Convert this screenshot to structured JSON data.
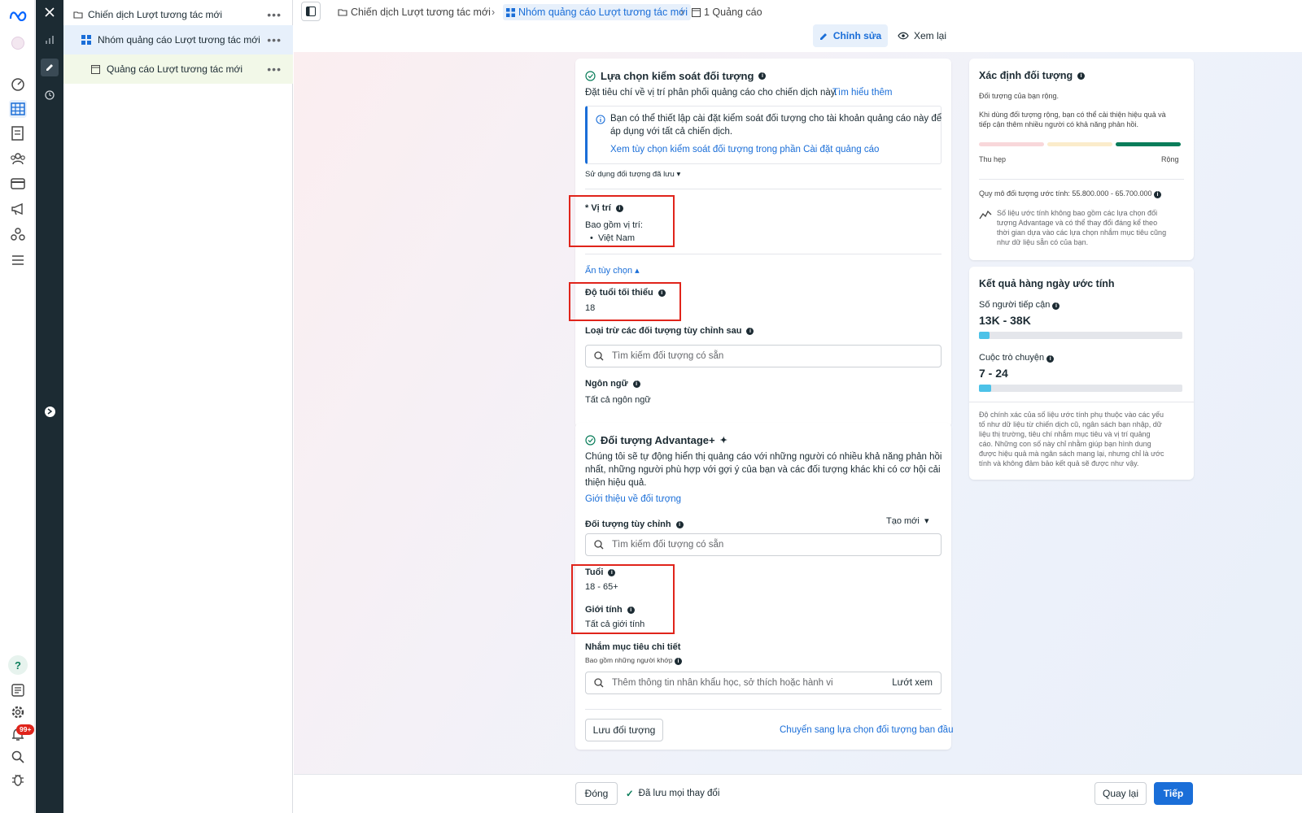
{
  "tree": {
    "campaign": "Chiến dịch Lượt tương tác mới",
    "adset": "Nhóm quảng cáo Lượt tương tác mới",
    "ad": "Quảng cáo Lượt tương tác mới"
  },
  "breadcrumb": {
    "campaign": "Chiến dịch Lượt tương tác mới",
    "adset": "Nhóm quảng cáo Lượt tương tác mới",
    "ads": "1 Quảng cáo"
  },
  "mode": {
    "edit": "Chỉnh sửa",
    "review": "Xem lại"
  },
  "notifications": {
    "badge": "99+"
  },
  "audience_controls": {
    "title": "Lựa chọn kiểm soát đối tượng",
    "desc": "Đặt tiêu chí về vị trí phân phối quảng cáo cho chiến dịch này.",
    "learn_more": "Tìm hiểu thêm",
    "notice_line1": "Bạn có thể thiết lập cài đặt kiểm soát đối tượng cho tài khoản quảng cáo này để",
    "notice_line2": "áp dụng với tất cả chiến dịch.",
    "notice_link": "Xem tùy chọn kiểm soát đối tượng trong phần Cài đặt quảng cáo",
    "saved_audience": "Sử dụng đối tượng đã lưu",
    "location_label": "* Vị trí",
    "location_include": "Bao gồm vị trí:",
    "location_value": "Việt Nam",
    "hide_options": "Ẩn tùy chọn",
    "min_age_label": "Độ tuổi tối thiểu",
    "min_age_value": "18",
    "exclude_label": "Loại trừ các đối tượng tùy chỉnh sau",
    "exclude_placeholder": "Tìm kiếm đối tượng có sẵn",
    "language_label": "Ngôn ngữ",
    "language_value": "Tất cả ngôn ngữ"
  },
  "advantage": {
    "title": "Đối tượng Advantage+",
    "desc_line1": "Chúng tôi sẽ tự động hiển thị quảng cáo với những người có nhiều khả năng phản hồi",
    "desc_line2": "nhất, những người phù hợp với gợi ý của bạn và các đối tượng khác khi có cơ hội cải",
    "desc_line3": "thiện hiệu quả.",
    "intro_link": "Giới thiệu về đối tượng",
    "custom_label": "Đối tượng tùy chỉnh",
    "create_new": "Tạo mới",
    "custom_placeholder": "Tìm kiếm đối tượng có sẵn",
    "age_label": "Tuổi",
    "age_value": "18 - 65+",
    "gender_label": "Giới tính",
    "gender_value": "Tất cả giới tính",
    "detailed_label": "Nhắm mục tiêu chi tiết",
    "detailed_sub": "Bao gồm những người khớp",
    "detailed_placeholder": "Thêm thông tin nhân khẩu học, sở thích hoặc hành vi",
    "browse": "Lướt xem",
    "save_button": "Lưu đối tượng",
    "switch_link": "Chuyển sang lựa chọn đối tượng ban đầu"
  },
  "audience_definition": {
    "title": "Xác định đối tượng",
    "status": "Đối tượng của bạn rộng.",
    "desc_line1": "Khi dùng đối tượng rộng, bạn có thể cải thiện hiệu quả và",
    "desc_line2": "tiếp cận thêm nhiều người có khả năng phản hồi.",
    "narrow": "Thu hẹp",
    "broad": "Rộng",
    "size_label": "Quy mô đối tượng ước tính: 55.800.000 - 65.700.000",
    "note_line1": "Số liệu ước tính không bao gồm các lựa chọn đối",
    "note_line2": "tượng Advantage và có thể thay đổi đáng kể theo",
    "note_line3": "thời gian dựa vào các lựa chọn nhắm mục tiêu cũng",
    "note_line4": "như dữ liệu sẵn có của bạn."
  },
  "daily_results": {
    "title": "Kết quả hàng ngày ước tính",
    "reach_label": "Số người tiếp cận",
    "reach_value": "13K - 38K",
    "reach_fill": 0.05,
    "conv_label": "Cuộc trò chuyện",
    "conv_value": "7 - 24",
    "conv_fill": 0.06,
    "disclaimer_line1": "Độ chính xác của số liệu ước tính phụ thuộc vào các yếu",
    "disclaimer_line2": "tố như dữ liệu từ chiến dịch cũ, ngân sách bạn nhập, dữ",
    "disclaimer_line3": "liệu thị trường, tiêu chí nhắm mục tiêu và vị trí quảng",
    "disclaimer_line4": "cáo. Những con số này chỉ nhằm giúp bạn hình dung",
    "disclaimer_line5": "được hiệu quả mà ngân sách mang lại, nhưng chỉ là ước",
    "disclaimer_line6": "tính và không đảm bảo kết quả sẽ được như vậy."
  },
  "footer": {
    "close": "Đóng",
    "saved": "Đã lưu mọi thay đổi",
    "back": "Quay lại",
    "next": "Tiếp"
  },
  "colors": {
    "accent": "#1a6ed8",
    "dark_sidebar": "#1c2b33",
    "highlight": "#e0241b",
    "bar": "#4cc2e8",
    "broad_bar": "#0a7d5a"
  }
}
